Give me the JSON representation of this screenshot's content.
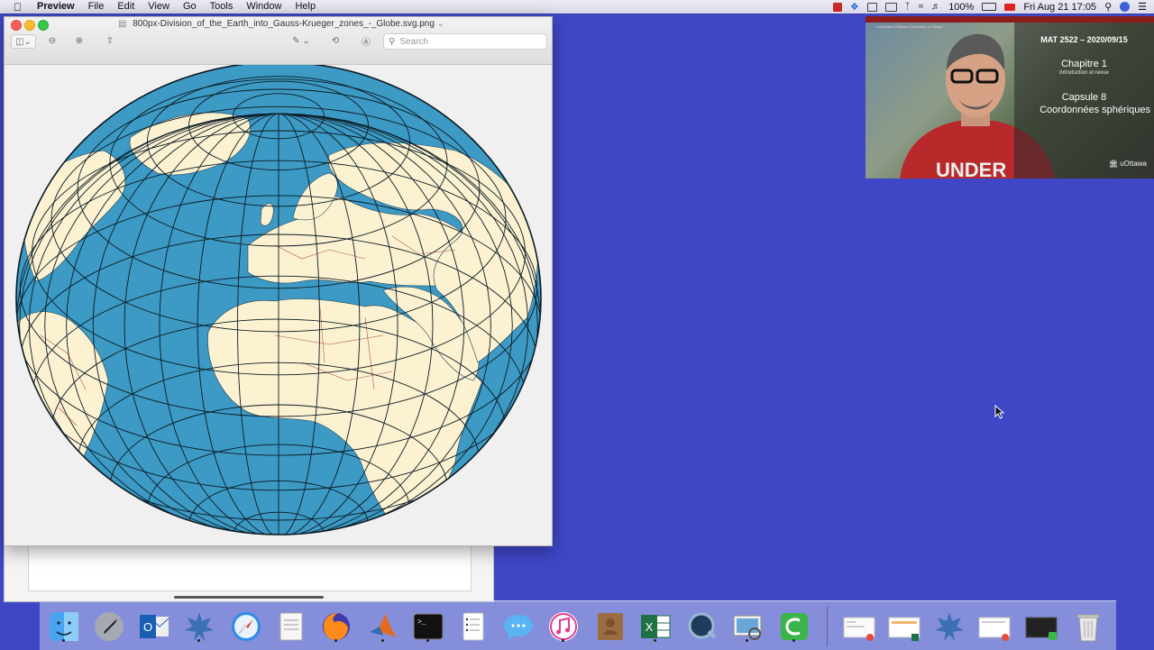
{
  "menubar": {
    "app": "Preview",
    "items": [
      "File",
      "Edit",
      "View",
      "Go",
      "Tools",
      "Window",
      "Help"
    ],
    "battery": "100%",
    "clock": "Fri Aug 21  17:05"
  },
  "preview_window": {
    "title": "800px-Division_of_the_Earth_into_Gauss-Krueger_zones_-_Globe.svg.png",
    "search_placeholder": "Search"
  },
  "webcam": {
    "banner_left": "Université d'Ottawa | University of Ottawa",
    "course": "MAT 2522 – 2020/09/15",
    "chapter": "Chapitre 1",
    "chapter_sub": "Introduction et revue",
    "capsule": "Capsule 8",
    "capsule_sub": "Coordonnées sphériques",
    "shirt_text": "UNDER",
    "logo": "uOttawa"
  },
  "dock": {
    "apps": [
      "Finder",
      "Launchpad",
      "Outlook",
      "Maple",
      "Safari",
      "TextEdit",
      "Firefox",
      "MATLAB",
      "Terminal",
      "Notes",
      "Messages",
      "iTunes",
      "Contacts",
      "Excel",
      "QuickTime Player",
      "Preview",
      "Camtasia"
    ],
    "right_items": [
      "Finder window",
      "Excel window",
      "Maple",
      "Preview window",
      "Terminal window",
      "Trash"
    ]
  },
  "colors": {
    "desktop": "#3f47c7",
    "ocean": "#3c9ac4",
    "land": "#fcf2d1"
  }
}
